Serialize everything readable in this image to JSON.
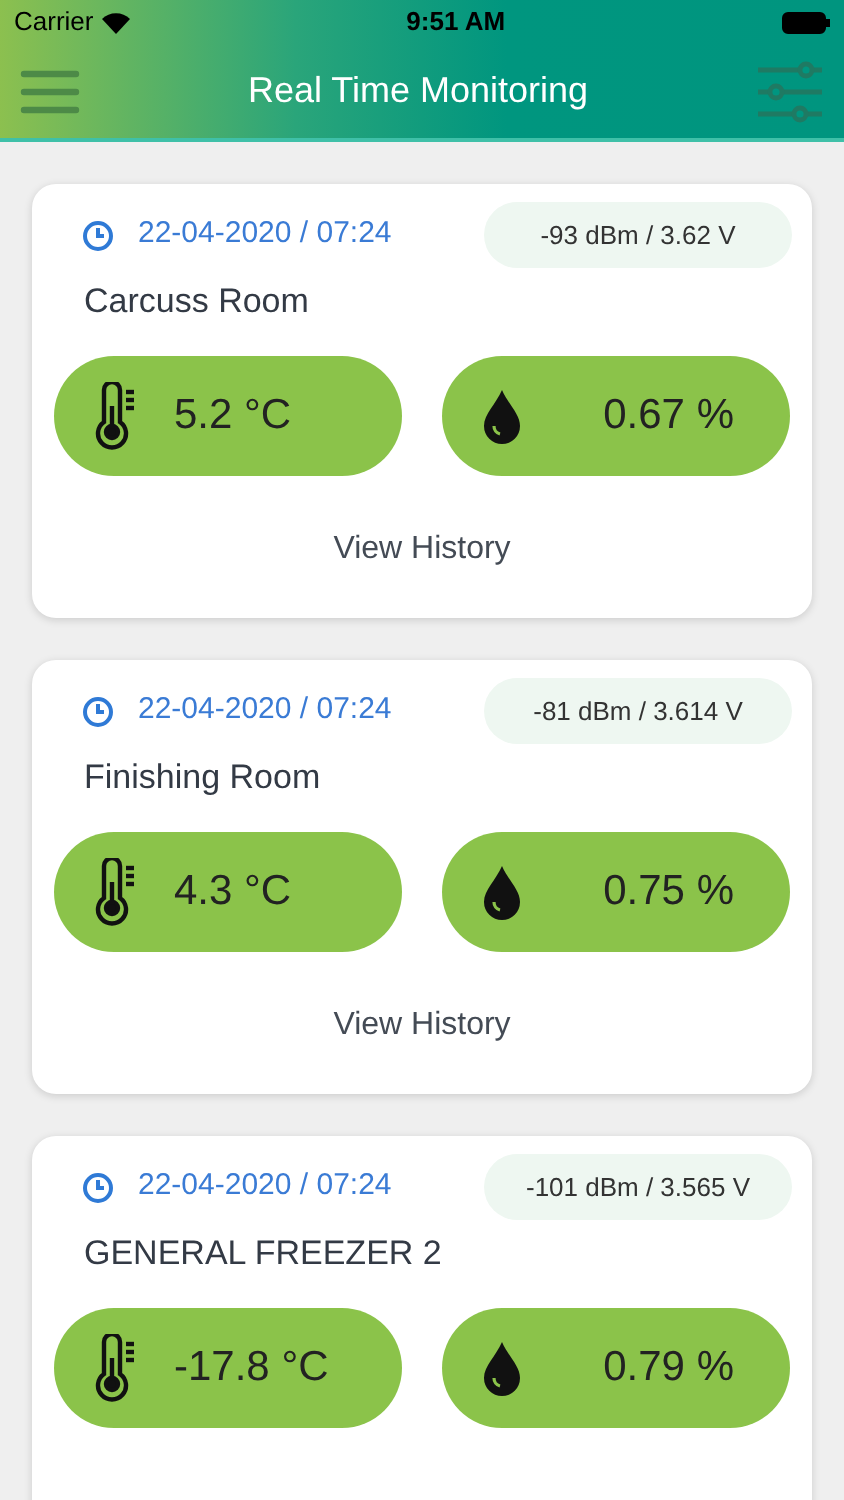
{
  "status_bar": {
    "carrier": "Carrier",
    "time": "9:51 AM"
  },
  "nav": {
    "title": "Real Time Monitoring"
  },
  "cards": [
    {
      "timestamp": "22-04-2020 / 07:24",
      "signal": "-93 dBm / 3.62 V",
      "name": "Carcuss Room",
      "temperature": "5.2 °C",
      "humidity": "0.67 %",
      "link": "View History"
    },
    {
      "timestamp": "22-04-2020 / 07:24",
      "signal": "-81 dBm / 3.614 V",
      "name": "Finishing Room",
      "temperature": "4.3 °C",
      "humidity": "0.75 %",
      "link": "View History"
    },
    {
      "timestamp": "22-04-2020 / 07:24",
      "signal": "-101 dBm / 3.565 V",
      "name": "GENERAL FREEZER 2",
      "temperature": "-17.8 °C",
      "humidity": "0.79 %"
    }
  ]
}
